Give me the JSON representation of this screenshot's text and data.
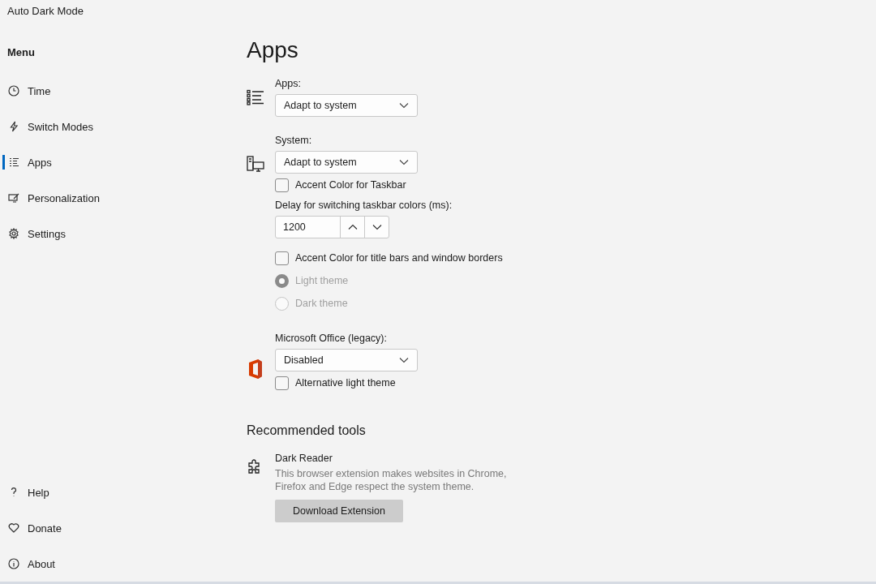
{
  "window": {
    "title": "Auto Dark Mode"
  },
  "sidebar": {
    "heading": "Menu",
    "items": [
      {
        "label": "Time",
        "selected": false
      },
      {
        "label": "Switch Modes",
        "selected": false
      },
      {
        "label": "Apps",
        "selected": true
      },
      {
        "label": "Personalization",
        "selected": false
      },
      {
        "label": "Settings",
        "selected": false
      }
    ],
    "footer_items": [
      {
        "label": "Help"
      },
      {
        "label": "Donate"
      },
      {
        "label": "About"
      }
    ]
  },
  "page": {
    "title": "Apps",
    "groups": [
      {
        "items": [
          {
            "kind": "select",
            "label": "Apps:",
            "value": "Adapt to system"
          }
        ]
      },
      {
        "items": [
          {
            "kind": "select",
            "label": "System:",
            "value": "Adapt to system"
          },
          {
            "kind": "checkbox",
            "label": "Accent Color for Taskbar",
            "checked": false,
            "disabled": false
          },
          {
            "kind": "spin",
            "label": "Delay for switching taskbar colors (ms):",
            "value": "1200"
          },
          {
            "kind": "checkbox",
            "label": "Accent Color for title bars and window borders",
            "checked": false,
            "disabled": false
          },
          {
            "kind": "radio",
            "label": "Light theme",
            "selected": true,
            "disabled": true
          },
          {
            "kind": "radio",
            "label": "Dark theme",
            "selected": false,
            "disabled": true
          }
        ]
      },
      {
        "items": [
          {
            "kind": "select",
            "label": "Microsoft Office (legacy):",
            "value": "Disabled"
          },
          {
            "kind": "checkbox",
            "label": "Alternative light theme",
            "checked": false,
            "disabled": false
          }
        ]
      }
    ],
    "recommended": {
      "heading": "Recommended tools",
      "tools": [
        {
          "name": "Dark Reader",
          "description": "This browser extension makes websites in Chrome, Firefox and Edge respect the system theme.",
          "button": "Download Extension"
        }
      ]
    }
  }
}
